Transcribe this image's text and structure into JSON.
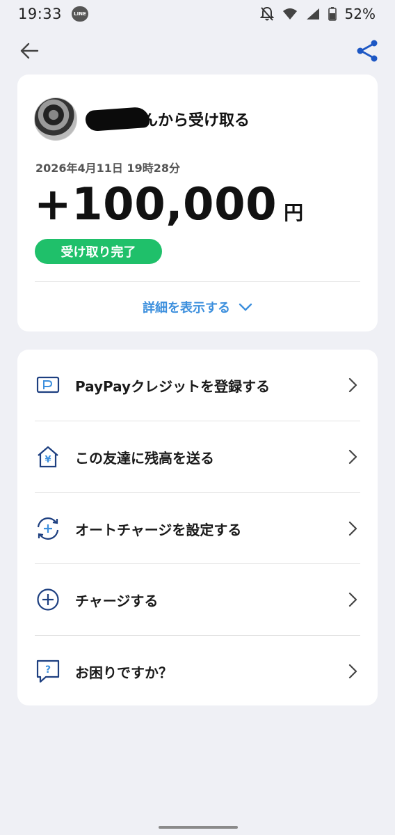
{
  "status_bar": {
    "time": "19:33",
    "line_badge": "LINE",
    "battery_percent": "52%"
  },
  "header": {
    "back_icon": "arrow-left-icon",
    "share_icon": "share-icon",
    "share_color": "#1d57c4"
  },
  "transaction": {
    "sender_suffix": "んから受け取る",
    "datetime": "2026年4月11日 19時28分",
    "amount": "+100,000",
    "currency": "円",
    "status": "受け取り完了",
    "status_color": "#1fc06a",
    "details_label": "詳細を表示する",
    "link_color": "#3c8fdd"
  },
  "menu": {
    "items": [
      {
        "label": "PayPayクレジットを登録する",
        "icon": "credit-card-icon"
      },
      {
        "label": "この友達に残高を送る",
        "icon": "yen-house-icon"
      },
      {
        "label": "オートチャージを設定する",
        "icon": "auto-charge-icon"
      },
      {
        "label": "チャージする",
        "icon": "plus-circle-icon"
      },
      {
        "label": "お困りですか？",
        "icon": "help-chat-icon"
      }
    ],
    "icon_color": "#1d3f80"
  }
}
